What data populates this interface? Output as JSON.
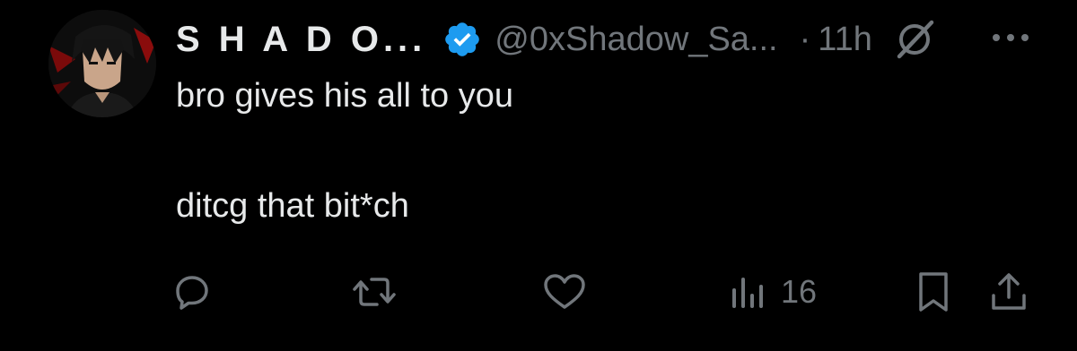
{
  "tweet": {
    "author": {
      "display_name": "S H A D O...",
      "handle": "@0xShadow_Sa...",
      "verified": true
    },
    "separator": "·",
    "time": "11h",
    "body": {
      "line1": "bro gives his all to you",
      "line2": "ditcg that bit*ch"
    },
    "actions": {
      "views": "16"
    },
    "icons": {
      "verified": "verified-badge-icon",
      "grok": "grok-icon",
      "more": "more-icon",
      "reply": "reply-icon",
      "retweet": "retweet-icon",
      "like": "heart-icon",
      "views": "views-chart-icon",
      "bookmark": "bookmark-icon",
      "share": "share-icon"
    }
  },
  "colors": {
    "background": "#000000",
    "primary_text": "#e7e9ea",
    "secondary_text": "#71767b",
    "verified_blue": "#1d9bf0"
  }
}
